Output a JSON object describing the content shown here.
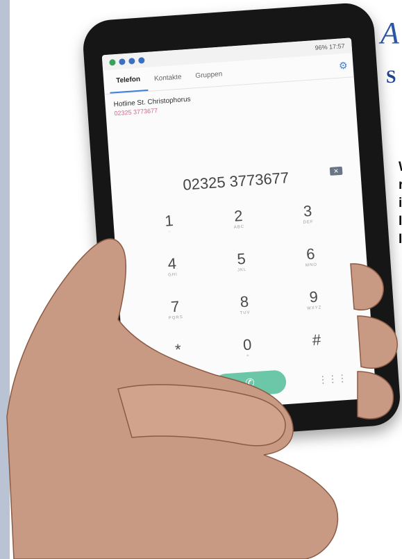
{
  "article": {
    "title_fragment": "A",
    "subtitle_fragment": "S",
    "line_fragments": [
      "W",
      "r",
      "i",
      "I",
      "I"
    ]
  },
  "phone": {
    "statusbar": {
      "right_text": "96% 17:57"
    },
    "tabs": [
      {
        "label": "Telefon",
        "active": true
      },
      {
        "label": "Kontakte",
        "active": false
      },
      {
        "label": "Gruppen",
        "active": false
      }
    ],
    "contact": {
      "name": "Hotline St. Christophorus",
      "number": "02325 3773677"
    },
    "dialed_number": "02325 3773677",
    "keys": [
      {
        "digit": "1",
        "letters": ""
      },
      {
        "digit": "2",
        "letters": "ABC"
      },
      {
        "digit": "3",
        "letters": "DEF"
      },
      {
        "digit": "4",
        "letters": "GHI"
      },
      {
        "digit": "5",
        "letters": "JKL"
      },
      {
        "digit": "6",
        "letters": "MNO"
      },
      {
        "digit": "7",
        "letters": "PQRS"
      },
      {
        "digit": "8",
        "letters": "TUV"
      },
      {
        "digit": "9",
        "letters": "WXYZ"
      },
      {
        "digit": "*",
        "letters": ""
      },
      {
        "digit": "0",
        "letters": "+"
      },
      {
        "digit": "#",
        "letters": ""
      }
    ]
  },
  "colors": {
    "accent": "#3b7fd6",
    "call": "#6bc7a8",
    "title": "#2e56a6"
  }
}
